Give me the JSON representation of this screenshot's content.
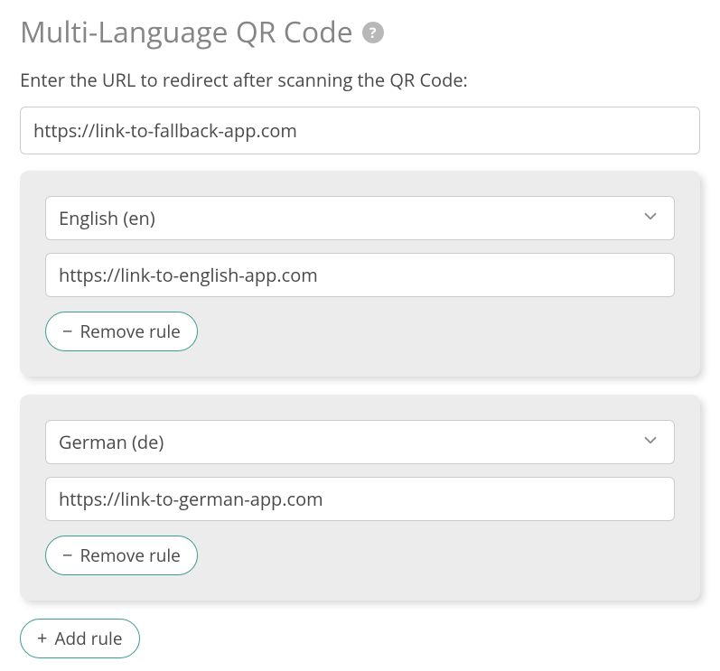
{
  "title": "Multi-Language QR Code",
  "instruction": "Enter the URL to redirect after scanning the QR Code:",
  "fallback_url": "https://link-to-fallback-app.com",
  "rules": [
    {
      "language": "English (en)",
      "url": "https://link-to-english-app.com",
      "remove_label": "Remove rule"
    },
    {
      "language": "German (de)",
      "url": "https://link-to-german-app.com",
      "remove_label": "Remove rule"
    }
  ],
  "add_rule_label": "Add rule"
}
